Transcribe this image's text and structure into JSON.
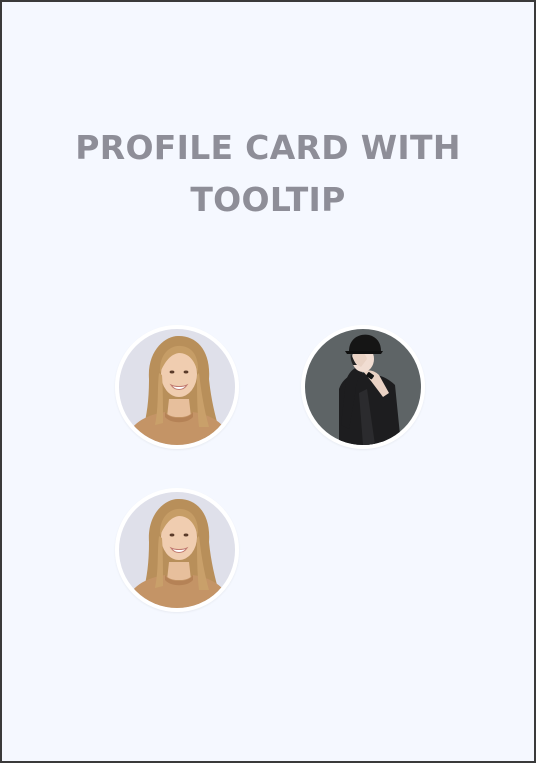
{
  "page": {
    "title": "PROFILE CARD WITH TOOLTIP"
  },
  "colors": {
    "background": "#f5f8ff",
    "title": "#8e8e98",
    "avatar_border": "#ffffff",
    "frame": "#3a3a3a"
  },
  "profiles": [
    {
      "avatar": "woman-portrait-icon"
    },
    {
      "avatar": "man-cap-illustration-icon"
    },
    {
      "avatar": "woman-portrait-icon"
    }
  ]
}
